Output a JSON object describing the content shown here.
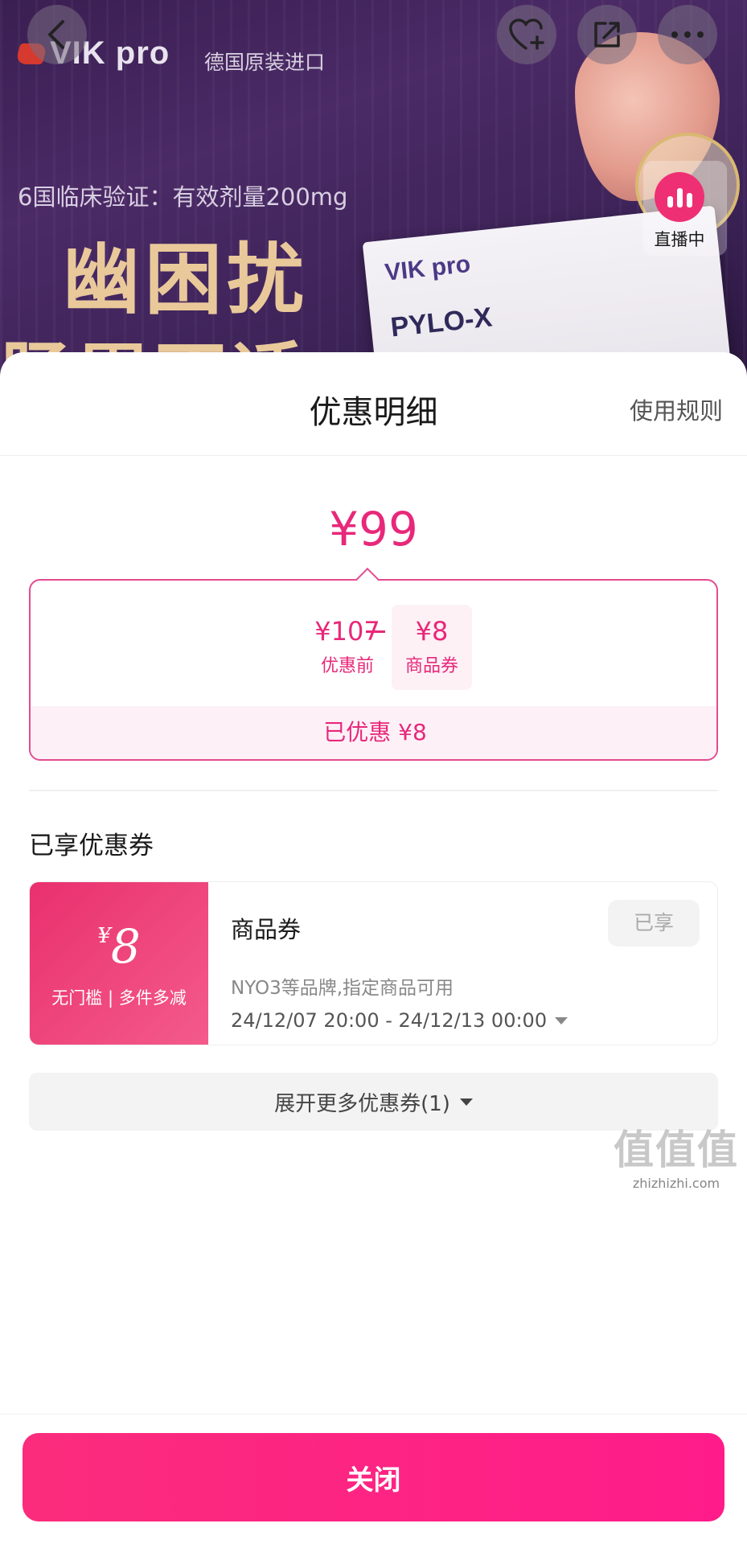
{
  "banner": {
    "brand": "VIK pro",
    "subtitle": "德国原装进口",
    "claim": "6国临床验证：有效剂量200mg",
    "headline": "幽困扰",
    "headline2": "肠胃不适",
    "product_logo": "VIK pro",
    "product_name": "PYLO-X",
    "live_label": "直播中"
  },
  "nav": {
    "back_icon": "chevron-left-icon",
    "favorite_icon": "heart-plus-icon",
    "share_icon": "share-icon",
    "more_icon": "more-dots-icon"
  },
  "sheet": {
    "title": "优惠明细",
    "rules_link": "使用规则",
    "final_price": "¥99",
    "breakdown": {
      "original_value": "¥107",
      "original_label": "优惠前",
      "coupon_value": "¥8",
      "coupon_label": "商品券",
      "saved_text": "已优惠 ¥8"
    },
    "section_title": "已享优惠券",
    "coupon": {
      "currency": "¥",
      "amount": "8",
      "condition": "无门槛 | 多件多减",
      "name": "商品券",
      "description": "NYO3等品牌,指定商品可用",
      "validity": "24/12/07 20:00 - 24/12/13 00:00",
      "status": "已享"
    },
    "expand_label": "展开更多优惠券(1)",
    "close_label": "关闭"
  },
  "watermark": {
    "text": "值值值",
    "domain": "zhizhizhi.com"
  },
  "colors": {
    "accent": "#e8287a",
    "button": "#fb2c7c",
    "banner_bg": "#3a1f52"
  }
}
